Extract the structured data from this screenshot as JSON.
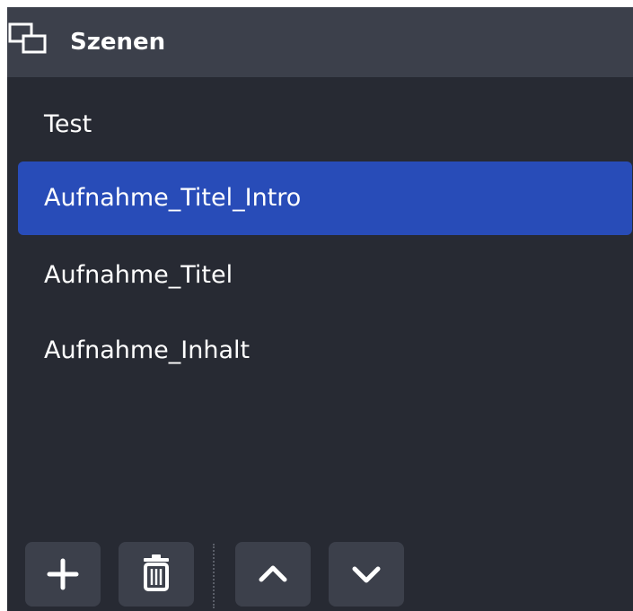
{
  "dock": {
    "title": "Szenen",
    "icon": "scenes-icon"
  },
  "scenes": [
    {
      "label": "Test",
      "selected": false
    },
    {
      "label": "Aufnahme_Titel_Intro",
      "selected": true
    },
    {
      "label": "Aufnahme_Titel",
      "selected": false
    },
    {
      "label": "Aufnahme_Inhalt",
      "selected": false
    }
  ],
  "toolbar": {
    "buttons": [
      {
        "icon": "plus-icon",
        "action": "add-scene"
      },
      {
        "icon": "trash-icon",
        "action": "remove-scene"
      },
      {
        "icon": "chevron-up-icon",
        "action": "move-scene-up"
      },
      {
        "icon": "chevron-down-icon",
        "action": "move-scene-down"
      }
    ]
  },
  "colors": {
    "panel_background": "#272a33",
    "header_background": "#3c404b",
    "selection": "#284cb8",
    "text": "#ffffff"
  }
}
